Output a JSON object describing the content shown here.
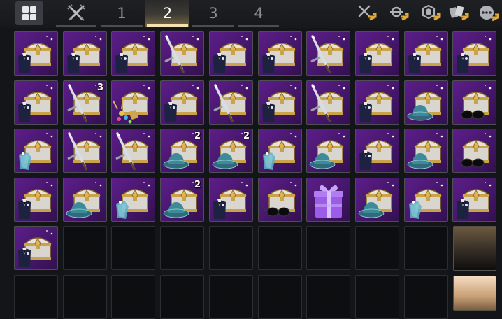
{
  "tabs": [
    {
      "label": "1",
      "active": false
    },
    {
      "label": "2",
      "active": true
    },
    {
      "label": "3",
      "active": false
    },
    {
      "label": "4",
      "active": false
    }
  ],
  "toolbar": {
    "grid_icon": "grid-view-icon",
    "tools_left": "crossed-swords-icon",
    "tools": [
      "disassemble-icon",
      "search-sort-icon",
      "gem-icon",
      "cards-icon",
      "more-options-icon"
    ]
  },
  "colors": {
    "tab_highlight": "#f4e3b0",
    "slot_purple": "#4a1872",
    "chest_gold": "#c9a24a"
  },
  "inventory": [
    {
      "row": 0,
      "col": 0,
      "item": "suit-chest"
    },
    {
      "row": 0,
      "col": 1,
      "item": "suit-chest"
    },
    {
      "row": 0,
      "col": 2,
      "item": "suit-chest"
    },
    {
      "row": 0,
      "col": 3,
      "item": "sword-chest"
    },
    {
      "row": 0,
      "col": 4,
      "item": "suit-chest"
    },
    {
      "row": 0,
      "col": 5,
      "item": "suit-chest"
    },
    {
      "row": 0,
      "col": 6,
      "item": "sword-chest"
    },
    {
      "row": 0,
      "col": 7,
      "item": "suit-chest"
    },
    {
      "row": 0,
      "col": 8,
      "item": "suit-chest"
    },
    {
      "row": 0,
      "col": 9,
      "item": "suit-chest"
    },
    {
      "row": 1,
      "col": 0,
      "item": "suit-chest"
    },
    {
      "row": 1,
      "col": 1,
      "item": "sword-chest",
      "count": "3"
    },
    {
      "row": 1,
      "col": 2,
      "item": "firework-chest"
    },
    {
      "row": 1,
      "col": 3,
      "item": "suit-chest"
    },
    {
      "row": 1,
      "col": 4,
      "item": "sword-chest"
    },
    {
      "row": 1,
      "col": 5,
      "item": "suit-chest"
    },
    {
      "row": 1,
      "col": 6,
      "item": "sword-chest"
    },
    {
      "row": 1,
      "col": 7,
      "item": "suit-chest"
    },
    {
      "row": 1,
      "col": 8,
      "item": "hat-chest"
    },
    {
      "row": 1,
      "col": 9,
      "item": "glasses-chest"
    },
    {
      "row": 2,
      "col": 0,
      "item": "cape-chest"
    },
    {
      "row": 2,
      "col": 1,
      "item": "sword-chest"
    },
    {
      "row": 2,
      "col": 2,
      "item": "sword-chest"
    },
    {
      "row": 2,
      "col": 3,
      "item": "hat-chest",
      "count": "2"
    },
    {
      "row": 2,
      "col": 4,
      "item": "hat-chest",
      "count": "2"
    },
    {
      "row": 2,
      "col": 5,
      "item": "cape-chest"
    },
    {
      "row": 2,
      "col": 6,
      "item": "hat-chest"
    },
    {
      "row": 2,
      "col": 7,
      "item": "suit-chest"
    },
    {
      "row": 2,
      "col": 8,
      "item": "hat-chest"
    },
    {
      "row": 2,
      "col": 9,
      "item": "glasses-chest"
    },
    {
      "row": 3,
      "col": 0,
      "item": "suit-chest"
    },
    {
      "row": 3,
      "col": 1,
      "item": "hat-chest"
    },
    {
      "row": 3,
      "col": 2,
      "item": "cape-chest"
    },
    {
      "row": 3,
      "col": 3,
      "item": "hat-chest",
      "count": "2"
    },
    {
      "row": 3,
      "col": 4,
      "item": "suit-chest"
    },
    {
      "row": 3,
      "col": 5,
      "item": "glasses-chest"
    },
    {
      "row": 3,
      "col": 6,
      "item": "gift-box"
    },
    {
      "row": 3,
      "col": 7,
      "item": "hat-chest"
    },
    {
      "row": 3,
      "col": 8,
      "item": "cape-chest"
    },
    {
      "row": 3,
      "col": 9,
      "item": "suit-chest"
    },
    {
      "row": 4,
      "col": 0,
      "item": "suit-chest"
    }
  ]
}
